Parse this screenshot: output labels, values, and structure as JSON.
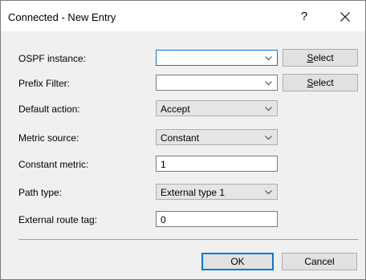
{
  "window": {
    "title": "Connected - New Entry",
    "help_label": "?",
    "close_icon": "close-icon"
  },
  "form": {
    "ospf_instance": {
      "label": "OSPF instance:",
      "value": "",
      "button_label": "Select",
      "button_mnemonic": "S",
      "button_rest": "elect"
    },
    "prefix_filter": {
      "label": "Prefix Filter:",
      "value": "",
      "button_label": "Select",
      "button_mnemonic": "S",
      "button_rest": "elect"
    },
    "default_action": {
      "label": "Default action:",
      "value": "Accept"
    },
    "metric_source": {
      "label": "Metric source:",
      "value": "Constant"
    },
    "constant_metric": {
      "label": "Constant metric:",
      "value": "1"
    },
    "path_type": {
      "label": "Path type:",
      "value": "External type 1"
    },
    "external_route_tag": {
      "label": "External route tag:",
      "value": "0"
    }
  },
  "footer": {
    "ok_label": "OK",
    "cancel_label": "Cancel"
  },
  "colors": {
    "focus_border": "#0078d7",
    "dialog_bg": "#f0f0f0"
  }
}
